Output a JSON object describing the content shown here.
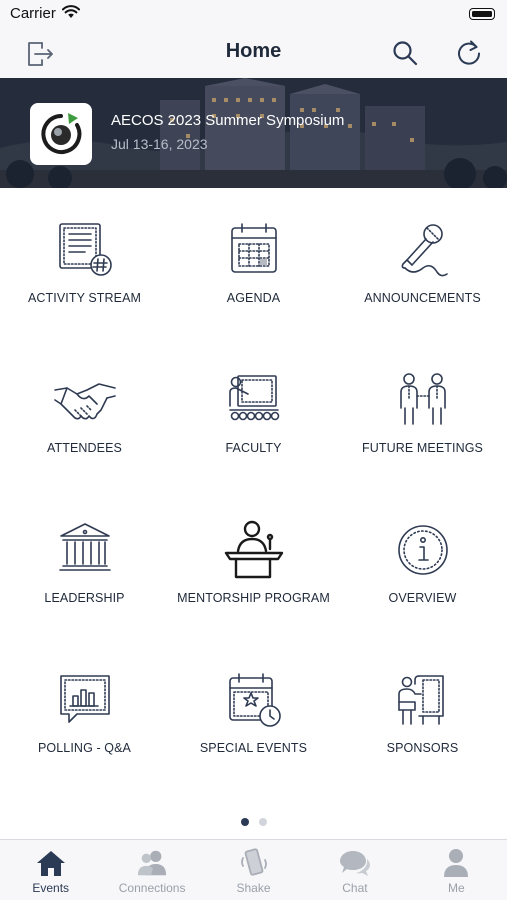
{
  "status_bar": {
    "carrier": "Carrier"
  },
  "header": {
    "title": "Home"
  },
  "banner": {
    "title": "AECOS 2023 Summer Symposium",
    "date": "Jul 13-16, 2023"
  },
  "tiles": [
    {
      "label": "ACTIVITY STREAM",
      "icon": "activity-stream-icon"
    },
    {
      "label": "AGENDA",
      "icon": "calendar-icon"
    },
    {
      "label": "ANNOUNCEMENTS",
      "icon": "microphone-icon"
    },
    {
      "label": "ATTENDEES",
      "icon": "handshake-icon"
    },
    {
      "label": "FACULTY",
      "icon": "presenter-icon"
    },
    {
      "label": "FUTURE MEETINGS",
      "icon": "people-meeting-icon"
    },
    {
      "label": "LEADERSHIP",
      "icon": "building-columns-icon"
    },
    {
      "label": "MENTORSHIP PROGRAM",
      "icon": "podium-speaker-icon"
    },
    {
      "label": "OVERVIEW",
      "icon": "info-icon"
    },
    {
      "label": "POLLING - Q&A",
      "icon": "bar-chart-icon"
    },
    {
      "label": "SPECIAL EVENTS",
      "icon": "calendar-star-icon"
    },
    {
      "label": "SPONSORS",
      "icon": "sponsor-board-icon"
    }
  ],
  "pager": {
    "pages": 2,
    "current": 1
  },
  "tab_bar": {
    "items": [
      {
        "label": "Events",
        "icon": "house-icon",
        "active": true
      },
      {
        "label": "Connections",
        "icon": "connections-icon",
        "active": false
      },
      {
        "label": "Shake",
        "icon": "shake-phone-icon",
        "active": false
      },
      {
        "label": "Chat",
        "icon": "chat-bubbles-icon",
        "active": false
      },
      {
        "label": "Me",
        "icon": "person-icon",
        "active": false
      }
    ]
  },
  "colors": {
    "accent": "#2b3a55",
    "icon_stroke": "#2f3b52",
    "inactive": "#9aa0aa",
    "bar_background": "#f7f7f9"
  }
}
